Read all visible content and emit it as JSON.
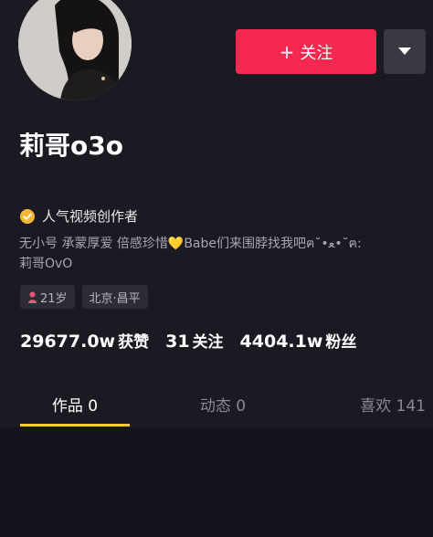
{
  "profile": {
    "username": "莉哥o3o",
    "follow_label": "关注",
    "follow_icon": "plus-icon",
    "more_icon": "caret-down-icon",
    "creator_badge_label": "人气视频创作者",
    "creator_badge_icon": "verified-check-icon",
    "bio_line1": "无小号 承蒙厚爱 倍感珍惜💛Babe们来围脖找我吧ฅ˘•ﻌ•˘ฅ:",
    "bio_line2": "莉哥OvO",
    "tags": {
      "age": "21岁",
      "location": "北京·昌平"
    }
  },
  "stats": {
    "likes_value": "29677.0w",
    "likes_label": "获赞",
    "following_value": "31",
    "following_label": "关注",
    "followers_value": "4404.1w",
    "followers_label": "粉丝"
  },
  "tabs": {
    "works": "作品 0",
    "dynamic": "动态 0",
    "likes": "喜欢 141",
    "active": "works"
  },
  "colors": {
    "follow_button": "#f5294f",
    "tab_indicator": "#facd2f",
    "badge": "#f6b833",
    "background": "#1b1a23"
  }
}
